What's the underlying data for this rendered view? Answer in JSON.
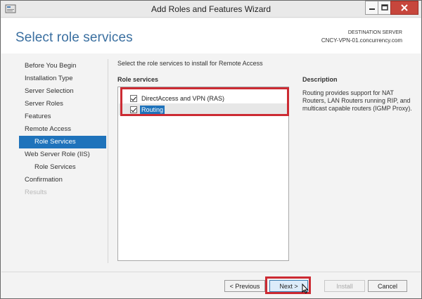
{
  "window": {
    "title": "Add Roles and Features Wizard",
    "controls": [
      "minimize-icon",
      "maximize-icon",
      "close-icon"
    ]
  },
  "header": {
    "page_title": "Select role services",
    "destination_label": "DESTINATION SERVER",
    "destination_value": "CNCY-VPN-01.concurrency.com"
  },
  "nav": {
    "items": [
      {
        "label": "Before You Begin",
        "state": "normal"
      },
      {
        "label": "Installation Type",
        "state": "normal"
      },
      {
        "label": "Server Selection",
        "state": "normal"
      },
      {
        "label": "Server Roles",
        "state": "normal"
      },
      {
        "label": "Features",
        "state": "normal"
      },
      {
        "label": "Remote Access",
        "state": "normal"
      },
      {
        "label": "Role Services",
        "state": "active"
      },
      {
        "label": "Web Server Role (IIS)",
        "state": "normal"
      },
      {
        "label": "Role Services",
        "state": "normal"
      },
      {
        "label": "Confirmation",
        "state": "normal"
      },
      {
        "label": "Results",
        "state": "disabled"
      }
    ]
  },
  "main": {
    "instruction": "Select the role services to install for Remote Access",
    "role_services_header": "Role services",
    "description_header": "Description",
    "role_services": [
      {
        "label": "DirectAccess and VPN (RAS)",
        "checked": true
      },
      {
        "label": "Routing",
        "checked": true,
        "selected": true
      }
    ],
    "description": "Routing provides support for NAT Routers, LAN Routers running RIP, and multicast capable routers (IGMP Proxy)."
  },
  "footer": {
    "previous_label": "< Previous",
    "next_label": "Next >",
    "install_label": "Install",
    "cancel_label": "Cancel"
  },
  "colors": {
    "accent": "#1f73bb",
    "title": "#3a6fa0",
    "highlight": "#cc2b33"
  }
}
